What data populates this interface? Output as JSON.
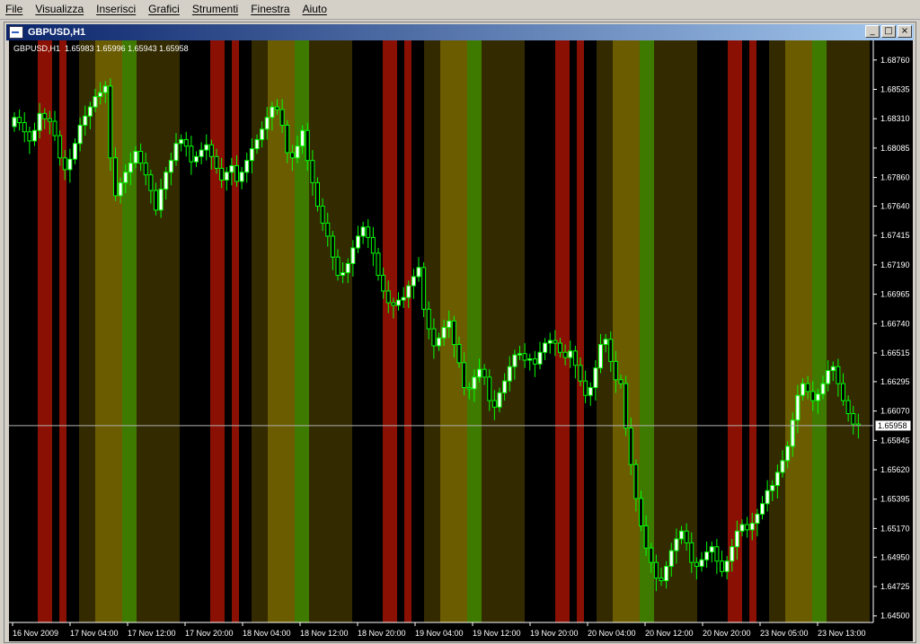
{
  "menu": [
    "File",
    "Visualizza",
    "Inserisci",
    "Grafici",
    "Strumenti",
    "Finestra",
    "Aiuto"
  ],
  "window": {
    "title": "GBPUSD,H1",
    "info_line": "GBPUSD,H1  1.65983 1.65996 1.65943 1.65958",
    "buttons": [
      "_",
      "□",
      "×"
    ]
  },
  "chart_data": {
    "type": "candlestick",
    "symbol": "GBPUSD",
    "timeframe": "H1",
    "current_price": "1.65958",
    "price_labels": [
      "1.68760",
      "1.68535",
      "1.68310",
      "1.68085",
      "1.67860",
      "1.67640",
      "1.67415",
      "1.67190",
      "1.66965",
      "1.66740",
      "1.66515",
      "1.66295",
      "1.66070",
      "1.65845",
      "1.65620",
      "1.65395",
      "1.65170",
      "1.64950",
      "1.64725",
      "1.64500"
    ],
    "ylim": [
      1.6445,
      1.6891
    ],
    "time_labels": [
      "16 Nov 2009",
      "17 Nov 04:00",
      "17 Nov 12:00",
      "17 Nov 20:00",
      "18 Nov 04:00",
      "18 Nov 12:00",
      "18 Nov 20:00",
      "19 Nov 04:00",
      "19 Nov 12:00",
      "19 Nov 20:00",
      "20 Nov 04:00",
      "20 Nov 12:00",
      "20 Nov 20:00",
      "23 Nov 05:00",
      "23 Nov 13:00"
    ],
    "session_band_colors": {
      "red": "#8b1004",
      "olive": "#332a00",
      "yellow": "#6b5c00",
      "green": "#3f7a00",
      "black": "#000000"
    },
    "candle_up_color": "#ffffff",
    "candle_down_color": "#000000",
    "wick_color": "#00ff00",
    "closes": [
      1.6832,
      1.6828,
      1.6821,
      1.6814,
      1.6822,
      1.6835,
      1.6831,
      1.6829,
      1.6818,
      1.6801,
      1.6792,
      1.68,
      1.6812,
      1.6826,
      1.6833,
      1.684,
      1.6848,
      1.6851,
      1.6856,
      1.6801,
      1.6772,
      1.6782,
      1.679,
      1.6797,
      1.6806,
      1.6797,
      1.6788,
      1.6776,
      1.6761,
      1.6777,
      1.679,
      1.6799,
      1.6812,
      1.6815,
      1.681,
      1.6798,
      1.6802,
      1.6807,
      1.6811,
      1.6802,
      1.6793,
      1.6784,
      1.679,
      1.6795,
      1.6783,
      1.679,
      1.6799,
      1.6808,
      1.6815,
      1.6823,
      1.6832,
      1.684,
      1.6838,
      1.6826,
      1.6805,
      1.6801,
      1.681,
      1.6822,
      1.6799,
      1.6782,
      1.6764,
      1.6751,
      1.6741,
      1.6725,
      1.6711,
      1.6713,
      1.672,
      1.6732,
      1.6741,
      1.6748,
      1.674,
      1.6728,
      1.6711,
      1.6699,
      1.669,
      1.6688,
      1.6692,
      1.6694,
      1.6703,
      1.671,
      1.6717,
      1.6685,
      1.667,
      1.6657,
      1.6663,
      1.6671,
      1.6676,
      1.6658,
      1.6644,
      1.6625,
      1.6624,
      1.6633,
      1.6639,
      1.6633,
      1.6615,
      1.661,
      1.6621,
      1.663,
      1.6641,
      1.665,
      1.6651,
      1.6646,
      1.6647,
      1.6643,
      1.6652,
      1.6659,
      1.6661,
      1.6659,
      1.6652,
      1.6648,
      1.6653,
      1.6642,
      1.663,
      1.6619,
      1.6625,
      1.664,
      1.6658,
      1.6662,
      1.6645,
      1.6631,
      1.6628,
      1.6594,
      1.6566,
      1.654,
      1.6519,
      1.6502,
      1.6491,
      1.6479,
      1.6477,
      1.6488,
      1.65,
      1.6509,
      1.6515,
      1.6506,
      1.6491,
      1.6488,
      1.6493,
      1.6499,
      1.6503,
      1.6492,
      1.6484,
      1.6492,
      1.6503,
      1.6515,
      1.652,
      1.6516,
      1.6521,
      1.6528,
      1.6536,
      1.6546,
      1.655,
      1.656,
      1.6569,
      1.658,
      1.66,
      1.6619,
      1.6628,
      1.6622,
      1.6615,
      1.662,
      1.6628,
      1.6638,
      1.6641,
      1.6628,
      1.6615,
      1.6605,
      1.6597,
      1.6596
    ]
  }
}
